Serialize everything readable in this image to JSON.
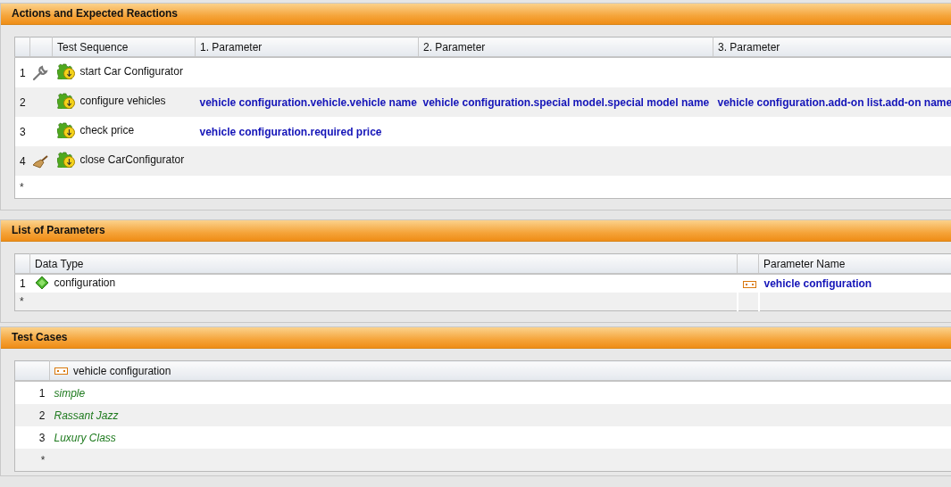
{
  "panels": [
    {
      "kind": "actions",
      "title": "Actions and Expected Reactions",
      "columns": [
        "Test Sequence",
        "1. Parameter",
        "2. Parameter",
        "3. Parameter"
      ],
      "rows": [
        {
          "number": "1",
          "kind": "wrench",
          "name": "start Car Configurator",
          "params": []
        },
        {
          "number": "2",
          "name": "configure vehicles",
          "params": [
            "vehicle configuration.vehicle.vehicle name",
            "vehicle configuration.special model.special model name",
            "vehicle configuration.add-on list.add-on name"
          ]
        },
        {
          "number": "3",
          "name": "check price",
          "params": [
            "vehicle configuration.required price"
          ]
        },
        {
          "number": "4",
          "kind": "broom",
          "name": "close CarConfigurator",
          "params": []
        }
      ],
      "new_row": "*"
    },
    {
      "kind": "parameters",
      "title": "List of Parameters",
      "columns": [
        "Data Type",
        "Parameter Name"
      ],
      "rows": [
        {
          "number": "1",
          "type": "configuration",
          "name": "vehicle configuration"
        }
      ],
      "new_row": "*"
    },
    {
      "kind": "cases",
      "title": "Test Cases",
      "columns": [
        "vehicle configuration"
      ],
      "rows": [
        {
          "number": "1",
          "name": "simple"
        },
        {
          "number": "2",
          "name": "Rassant Jazz"
        },
        {
          "number": "3",
          "name": "Luxury Class"
        }
      ],
      "new_row": "*"
    }
  ]
}
